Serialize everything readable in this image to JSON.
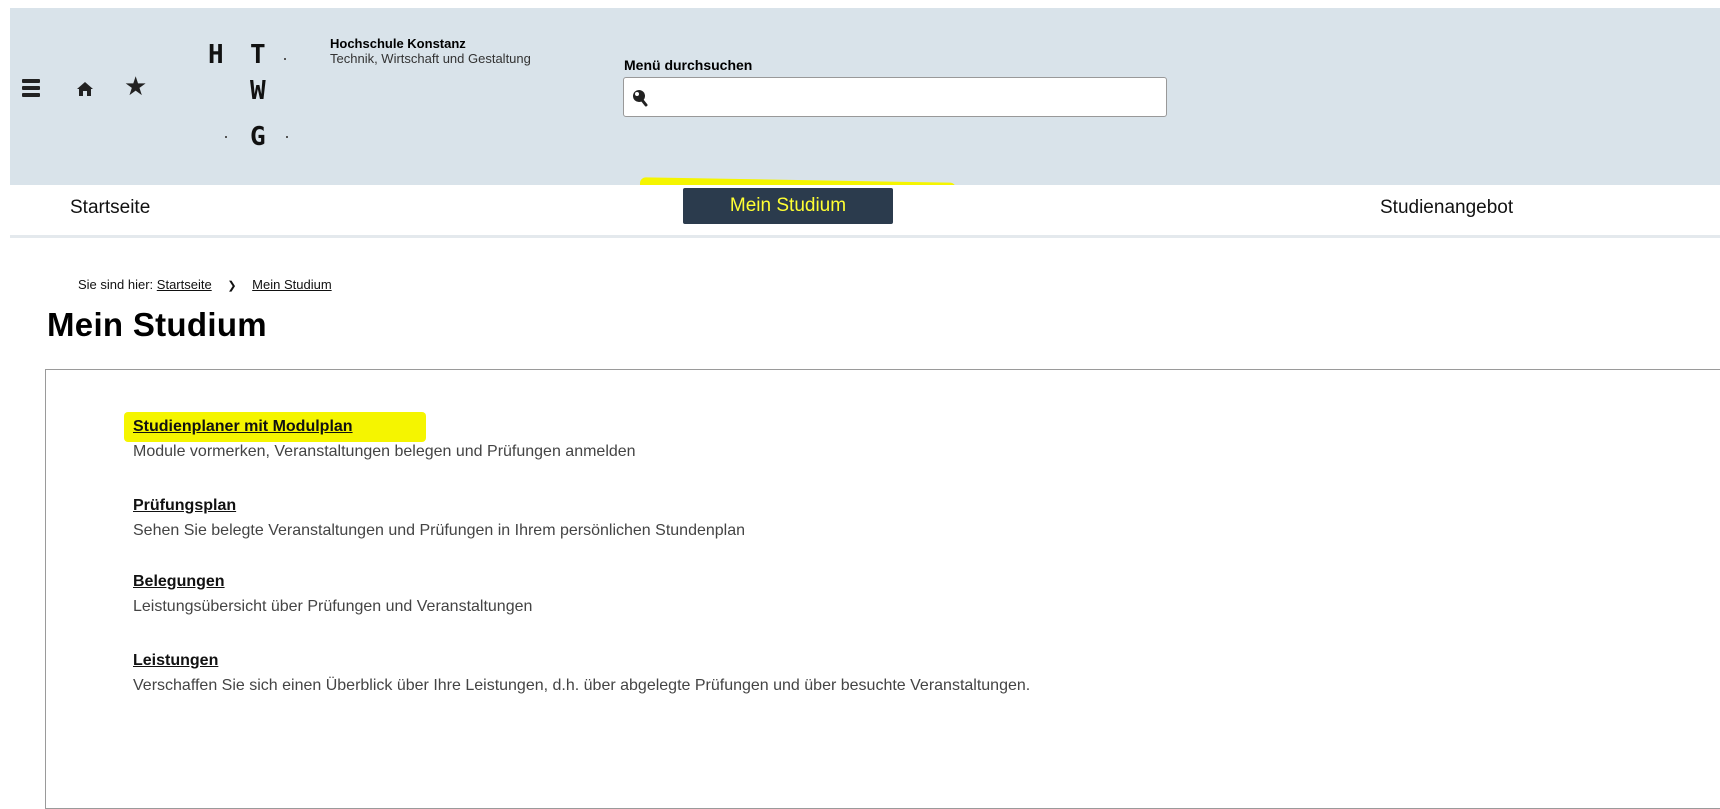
{
  "header": {
    "institution_name": "Hochschule Konstanz",
    "institution_sub": "Technik, Wirtschaft und Gestaltung",
    "logo_letters": [
      "H",
      "T",
      "W",
      "G"
    ],
    "search": {
      "label": "Menü durchsuchen",
      "value": "",
      "placeholder": ""
    },
    "icons": [
      "menu-icon",
      "home-icon",
      "star-icon",
      "search-icon"
    ]
  },
  "nav": {
    "items": [
      {
        "label": "Startseite",
        "active": false
      },
      {
        "label": "Mein Studium",
        "active": true
      },
      {
        "label": "Studienangebot",
        "active": false
      }
    ]
  },
  "breadcrumb": {
    "prefix": "Sie sind hier:",
    "items": [
      "Startseite",
      "Mein Studium"
    ]
  },
  "page": {
    "title": "Mein Studium"
  },
  "entries": [
    {
      "title": "Studienplaner mit Modulplan",
      "description": "Module vormerken, Veranstaltungen belegen und Prüfungen anmelden"
    },
    {
      "title": "Prüfungsplan",
      "description": "Sehen Sie belegte Veranstaltungen und Prüfungen in Ihrem persönlichen Stundenplan"
    },
    {
      "title": "Belegungen",
      "description": "Leistungsübersicht über Prüfungen und Veranstaltungen"
    },
    {
      "title": "Leistungen",
      "description": "Verschaffen Sie sich einen Überblick über Ihre Leistungen, d.h. über abgelegte Prüfungen und über besuchte Veranstaltungen."
    }
  ],
  "colors": {
    "header_bg": "#d9e3ea",
    "nav_active_bg": "#2b3b4d",
    "nav_active_text": "#ffff33",
    "highlight": "#f5f500"
  }
}
